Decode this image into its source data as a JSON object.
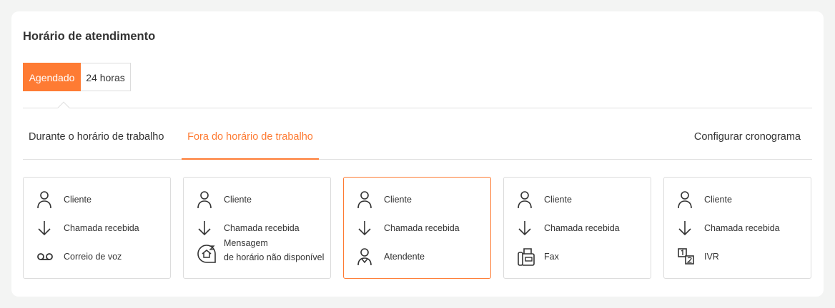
{
  "page": {
    "title": "Horário de atendimento"
  },
  "mode_toggle": {
    "options": [
      "Agendado",
      "24 horas"
    ],
    "selected": "Agendado"
  },
  "tabs": {
    "items": [
      "Durante o horário de trabalho",
      "Fora do horário de trabalho"
    ],
    "active": "Fora do horário de trabalho",
    "action": "Configurar cronograma"
  },
  "colors": {
    "accent": "#fe7b33",
    "border": "#dcdcdc"
  },
  "cards": [
    {
      "step1": "Cliente",
      "step2": "Chamada recebida",
      "step3": "Correio de voz",
      "icon3": "voicemail-icon",
      "selected": false
    },
    {
      "step1": "Cliente",
      "step2": "Chamada recebida",
      "step3_line1": "Mensagem",
      "step3_line2": "de horário não disponível",
      "icon3": "home-message-icon",
      "selected": false
    },
    {
      "step1": "Cliente",
      "step2": "Chamada recebida",
      "step3": "Atendente",
      "icon3": "agent-icon",
      "selected": true
    },
    {
      "step1": "Cliente",
      "step2": "Chamada recebida",
      "step3": "Fax",
      "icon3": "fax-icon",
      "selected": false
    },
    {
      "step1": "Cliente",
      "step2": "Chamada recebida",
      "step3": "IVR",
      "icon3": "ivr-icon",
      "selected": false
    }
  ]
}
